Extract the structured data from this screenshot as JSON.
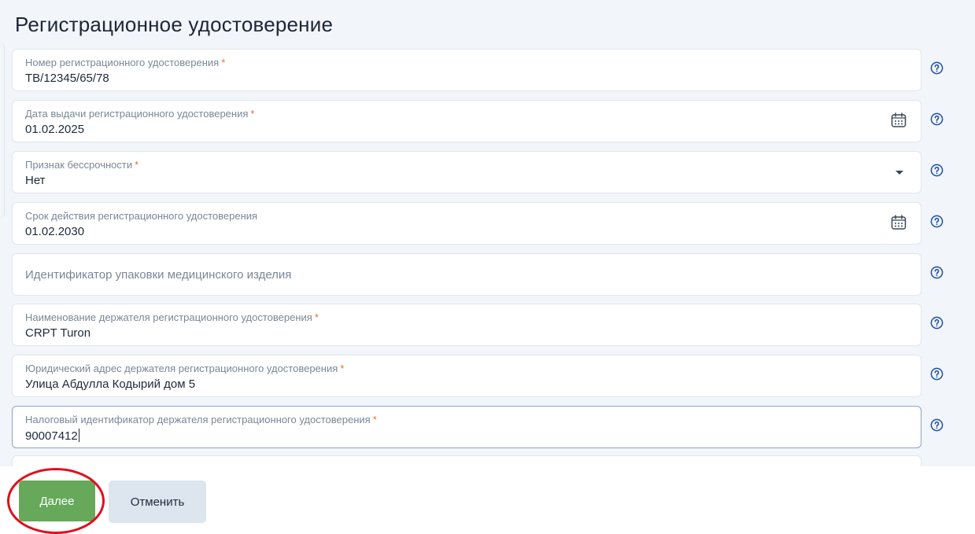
{
  "page": {
    "title": "Регистрационное удостоверение"
  },
  "fields": [
    {
      "label": "Номер регистрационного удостоверения",
      "required": "*",
      "value": "ТВ/12345/65/78",
      "type": "text"
    },
    {
      "label": "Дата выдачи регистрационного удостоверения",
      "required": "*",
      "value": "01.02.2025",
      "type": "date",
      "icon": "calendar-icon"
    },
    {
      "label": "Признак бессрочности",
      "required": "*",
      "value": "Нет",
      "type": "select",
      "icon": "chevron-down-icon"
    },
    {
      "label": "Срок действия регистрационного удостоверения",
      "value": "01.02.2030",
      "type": "date",
      "icon": "calendar-icon"
    },
    {
      "placeholder": "Идентификатор упаковки медицинского изделия",
      "type": "text"
    },
    {
      "label": "Наименование держателя регистрационного удостоверения",
      "required": "*",
      "value": "CRPT Turon",
      "type": "text"
    },
    {
      "label": "Юридический адрес держателя регистрационного удостоверения",
      "required": "*",
      "value": "Улица Абдулла Кодырий дом 5",
      "type": "text"
    },
    {
      "label": "Налоговый идентификатор держателя регистрационного удостоверения",
      "required": "*",
      "value": "90007412",
      "type": "text",
      "focused": true
    }
  ],
  "footer": {
    "next_label": "Далее",
    "cancel_label": "Отменить"
  },
  "colors": {
    "primary_green": "#66a95a",
    "required_orange": "#e9712b",
    "help_blue": "#1d4fa8",
    "annotation_red": "#e0101c"
  }
}
